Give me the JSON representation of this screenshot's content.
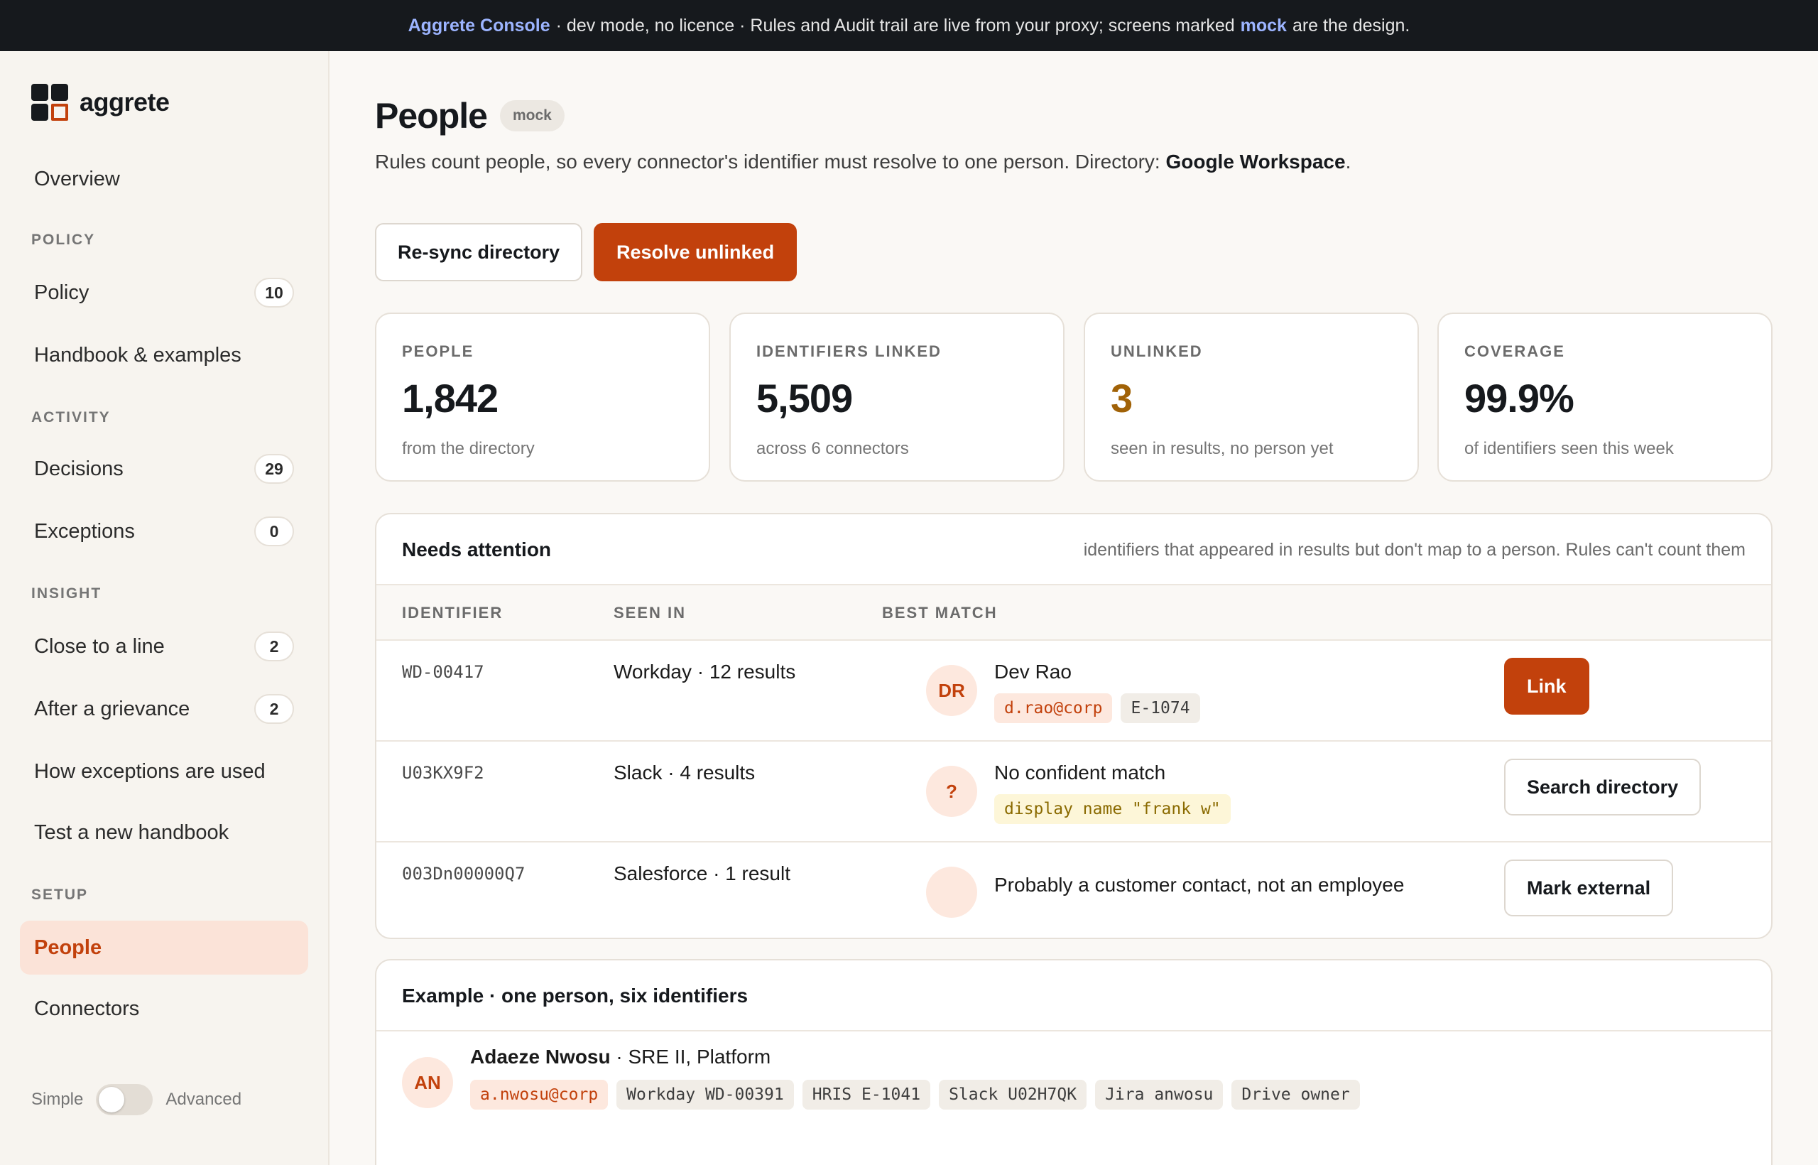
{
  "banner": {
    "app_name": "Aggrete Console",
    "text_middle": "· dev mode, no licence · Rules and Audit trail are live from your proxy; screens marked",
    "mock_word": "mock",
    "text_end": "are the design."
  },
  "logo": {
    "text": "aggrete"
  },
  "sidebar": {
    "overview": "Overview",
    "sections": {
      "policy": "POLICY",
      "activity": "ACTIVITY",
      "insight": "INSIGHT",
      "setup": "SETUP"
    },
    "items": {
      "policy": {
        "label": "Policy",
        "count": "10"
      },
      "handbook": {
        "label": "Handbook & examples"
      },
      "decisions": {
        "label": "Decisions",
        "count": "29"
      },
      "exceptions": {
        "label": "Exceptions",
        "count": "0"
      },
      "close_to_line": {
        "label": "Close to a line",
        "count": "2"
      },
      "after_grievance": {
        "label": "After a grievance",
        "count": "2"
      },
      "how_exceptions": {
        "label": "How exceptions are used"
      },
      "test_handbook": {
        "label": "Test a new handbook"
      },
      "people": {
        "label": "People"
      },
      "connectors": {
        "label": "Connectors"
      }
    },
    "mode": {
      "simple": "Simple",
      "advanced": "Advanced"
    }
  },
  "page": {
    "title": "People",
    "badge": "mock",
    "subtitle_prefix": "Rules count people, so every connector's identifier must resolve to one person. Directory:",
    "directory_name": "Google Workspace",
    "subtitle_suffix": "."
  },
  "actions": {
    "resync": "Re-sync directory",
    "resolve": "Resolve unlinked"
  },
  "stats": [
    {
      "label": "PEOPLE",
      "value": "1,842",
      "sub": "from the directory"
    },
    {
      "label": "IDENTIFIERS LINKED",
      "value": "5,509",
      "sub": "across 6 connectors"
    },
    {
      "label": "UNLINKED",
      "value": "3",
      "sub": "seen in results, no person yet"
    },
    {
      "label": "COVERAGE",
      "value": "99.9%",
      "sub": "of identifiers seen this week"
    }
  ],
  "attention": {
    "title": "Needs attention",
    "note": "identifiers that appeared in results but don't map to a person. Rules can't count them",
    "columns": {
      "identifier": "IDENTIFIER",
      "seen_in": "SEEN IN",
      "best_match": "BEST MATCH"
    },
    "rows": [
      {
        "identifier": "WD-00417",
        "seen_in": "Workday · 12 results",
        "avatar": "DR",
        "match": "Dev Rao",
        "chips": [
          "d.rao@corp",
          "E-1074"
        ],
        "action": "Link"
      },
      {
        "identifier": "U03KX9F2",
        "seen_in": "Slack · 4 results",
        "avatar": "?",
        "match": "No confident match",
        "chips": [
          "display name \"frank w\""
        ],
        "action": "Search directory"
      },
      {
        "identifier": "003Dn00000Q7",
        "seen_in": "Salesforce · 1 result",
        "avatar": "",
        "match": "Probably a customer contact, not an employee",
        "action": "Mark external"
      }
    ]
  },
  "example": {
    "title": "Example · one person, six identifiers",
    "avatar": "AN",
    "name": "Adaeze Nwosu",
    "role": "· SRE II, Platform",
    "identifiers": [
      "a.nwosu@corp",
      "Workday WD-00391",
      "HRIS E-1041",
      "Slack U02H7QK",
      "Jira anwosu",
      "Drive owner"
    ]
  },
  "colors": {
    "accent": "#c2410c",
    "banner_bg": "#16191d",
    "banner_link": "#9cb4ff",
    "warn": "#a16207"
  }
}
